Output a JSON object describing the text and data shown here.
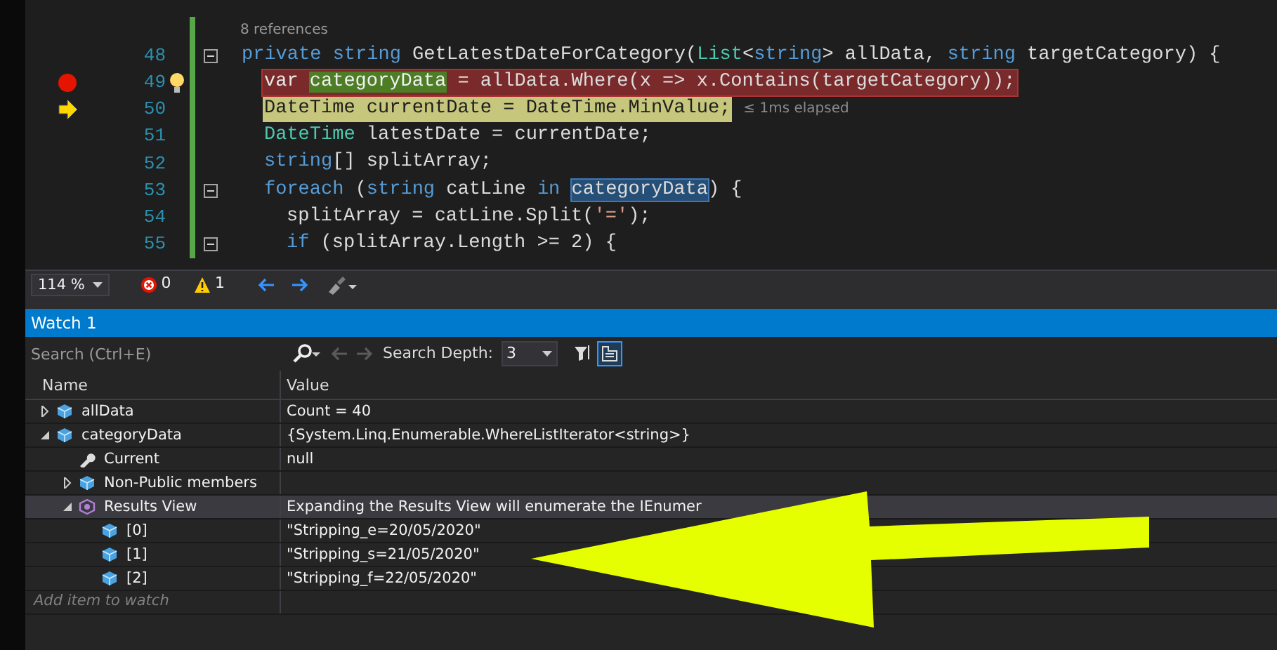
{
  "editor": {
    "lines": [
      {
        "kind": "codelens",
        "text": "8 references"
      },
      {
        "kind": "code",
        "number": "48",
        "breakpoint": false,
        "current": false,
        "lightbulb": false,
        "fold": true,
        "tokens": [
          {
            "text": "private ",
            "kind": "keyword"
          },
          {
            "text": "string",
            "kind": "keyword"
          },
          {
            "text": " GetLatestDateForCategory(",
            "kind": "plain"
          },
          {
            "text": "List",
            "kind": "type"
          },
          {
            "text": "<",
            "kind": "plain"
          },
          {
            "text": "string",
            "kind": "keyword"
          },
          {
            "text": "> allData, ",
            "kind": "plain"
          },
          {
            "text": "string",
            "kind": "keyword"
          },
          {
            "text": " targetCategory) {",
            "kind": "plain"
          }
        ],
        "children": [
          {
            "kind": "code",
            "number": "49",
            "breakpoint": true,
            "current": false,
            "lightbulb": true,
            "fold": false,
            "tokens": [
              {
                "text": "var ",
                "kind": "keyword"
              },
              {
                "text": "categoryData",
                "kind": "definition"
              },
              {
                "text": " = allData.Where(x => x.Contains(targetCategory));",
                "kind": "plain"
              }
            ]
          },
          {
            "kind": "code",
            "number": "50",
            "breakpoint": false,
            "current": true,
            "lightbulb": false,
            "fold": false,
            "hint": "≤ 1ms elapsed",
            "tokens": [
              {
                "text": "DateTime currentDate = DateTime.MinValue;",
                "kind": "plain"
              }
            ]
          },
          {
            "kind": "code",
            "number": "51",
            "breakpoint": false,
            "current": false,
            "lightbulb": false,
            "fold": false,
            "tokens": [
              {
                "text": "DateTime",
                "kind": "type"
              },
              {
                "text": " latestDate = currentDate;",
                "kind": "plain"
              }
            ]
          },
          {
            "kind": "code",
            "number": "52",
            "breakpoint": false,
            "current": false,
            "lightbulb": false,
            "fold": false,
            "tokens": [
              {
                "text": "string",
                "kind": "keyword"
              },
              {
                "text": "[] splitArray;",
                "kind": "plain"
              }
            ]
          },
          {
            "kind": "code",
            "number": "53",
            "breakpoint": false,
            "current": false,
            "lightbulb": false,
            "fold": true,
            "tokens": [
              {
                "text": "foreach",
                "kind": "keyword"
              },
              {
                "text": " (",
                "kind": "plain"
              },
              {
                "text": "string",
                "kind": "keyword"
              },
              {
                "text": " catLine ",
                "kind": "plain"
              },
              {
                "text": "in ",
                "kind": "keyword"
              },
              {
                "text": "categoryData",
                "kind": "reference"
              },
              {
                "text": ") {",
                "kind": "plain"
              }
            ],
            "children": [
              {
                "kind": "code",
                "number": "54",
                "breakpoint": false,
                "current": false,
                "lightbulb": false,
                "fold": false,
                "tokens": [
                  {
                    "text": "splitArray = catLine.Split(",
                    "kind": "plain"
                  },
                  {
                    "text": "'='",
                    "kind": "string"
                  },
                  {
                    "text": ");",
                    "kind": "plain"
                  }
                ]
              },
              {
                "kind": "code",
                "number": "55",
                "breakpoint": false,
                "current": false,
                "lightbulb": false,
                "fold": true,
                "tokens": [
                  {
                    "text": "if",
                    "kind": "keyword"
                  },
                  {
                    "text": " (splitArray.Length >= 2) {",
                    "kind": "plain"
                  }
                ]
              }
            ]
          }
        ]
      }
    ]
  },
  "status_bar": {
    "zoom": "114 %",
    "errors": "0",
    "warnings": "1"
  },
  "watch": {
    "title": "Watch 1",
    "search": {
      "placeholder": "Search (Ctrl+E)"
    },
    "depth_label": "Search Depth:",
    "depth": "3",
    "columns": [
      "Name",
      "Value"
    ],
    "rows": [
      {
        "name": "allData",
        "value": "Count = 40",
        "kind": "field",
        "expanded": false,
        "selected": false
      },
      {
        "name": "categoryData",
        "value": "{System.Linq.Enumerable.WhereListIterator<string>}",
        "kind": "field",
        "expanded": true,
        "selected": false,
        "children": [
          {
            "name": "Current",
            "value": "null",
            "kind": "property",
            "selected": false
          },
          {
            "name": "Non-Public members",
            "kind": "field",
            "expanded": false,
            "selected": false
          },
          {
            "name": "Results View",
            "value": "Expanding the Results View will enumerate the IEnumer",
            "kind": "results",
            "expanded": true,
            "selected": true,
            "children": [
              {
                "name": "[0]",
                "value": "\"Stripping_e=20/05/2020\"",
                "kind": "field",
                "selected": false
              },
              {
                "name": "[1]",
                "value": "\"Stripping_s=21/05/2020\"",
                "kind": "field",
                "selected": false
              },
              {
                "name": "[2]",
                "value": "\"Stripping_f=22/05/2020\"",
                "kind": "field",
                "selected": false
              }
            ]
          }
        ]
      }
    ],
    "add_placeholder": "Add item to watch"
  }
}
